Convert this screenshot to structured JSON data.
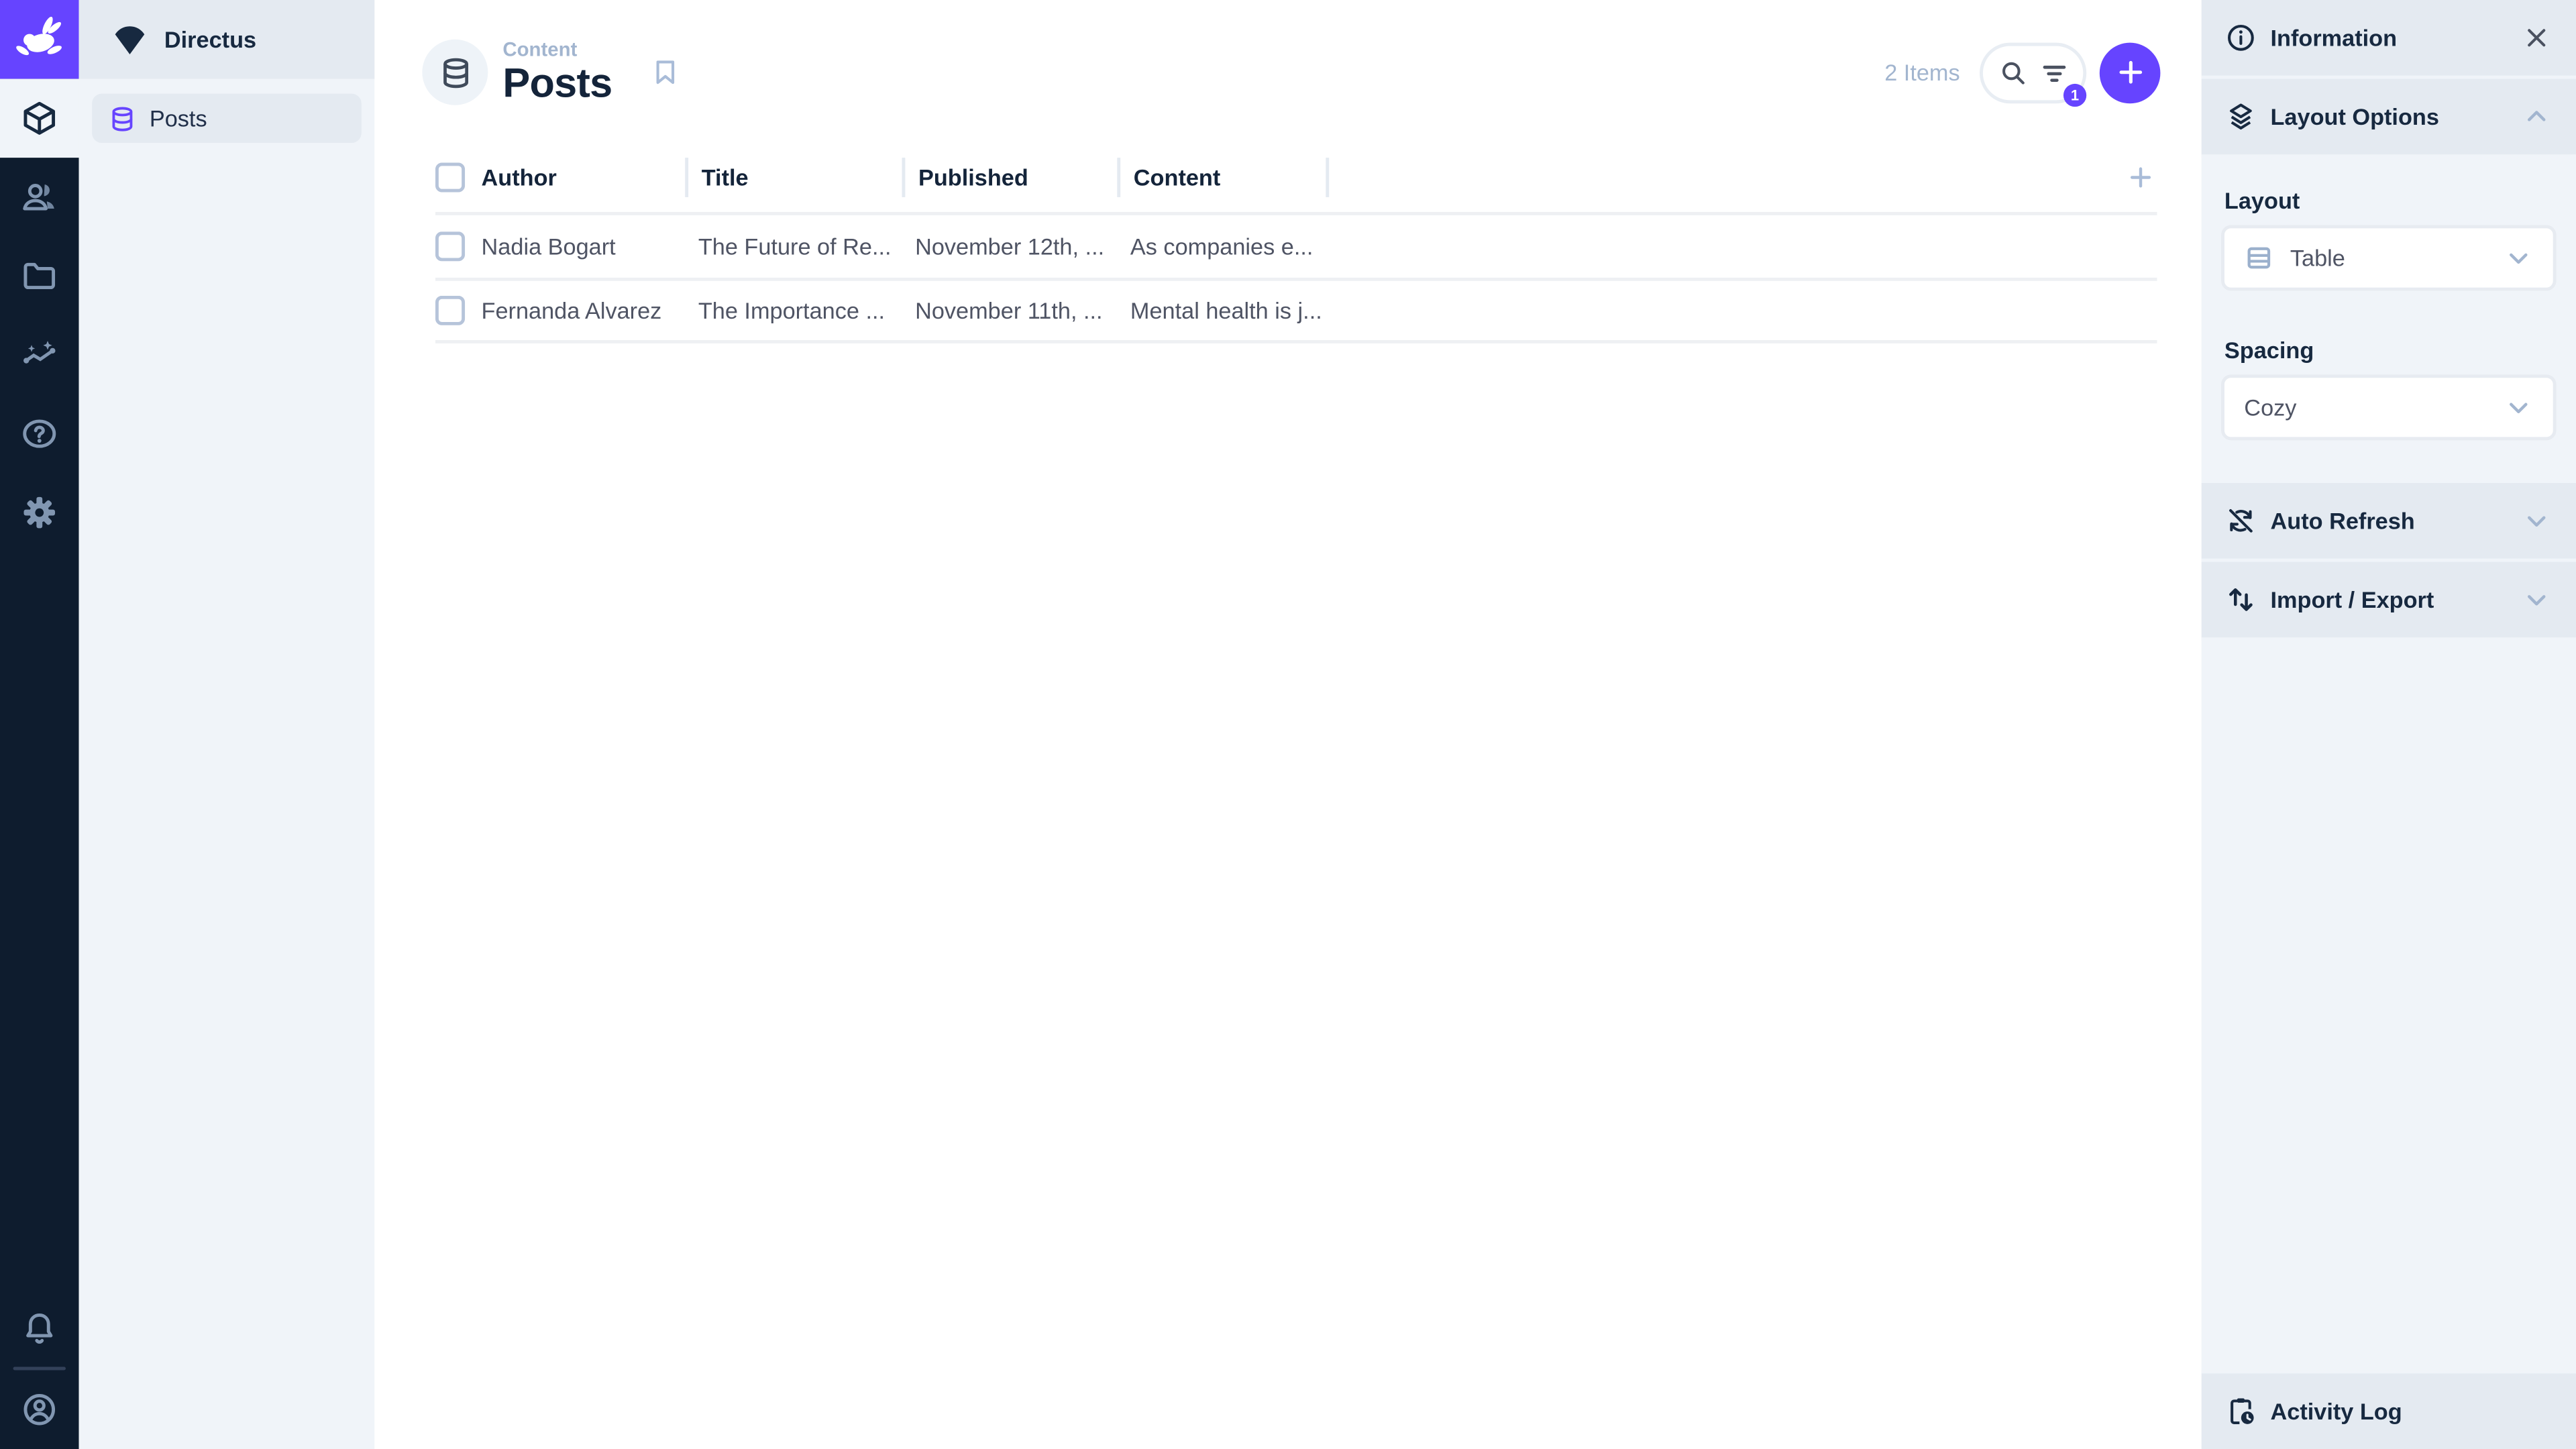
{
  "app": {
    "accent_color": "#6644ff",
    "module_bar_color": "#0e1c2e"
  },
  "sidebar": {
    "project_name": "Directus",
    "items": [
      {
        "label": "Posts",
        "icon": "database-icon",
        "active": true
      }
    ]
  },
  "header": {
    "breadcrumb": "Content",
    "title": "Posts",
    "items_count": "2 Items",
    "filter_badge_count": "1"
  },
  "table": {
    "columns": [
      "Author",
      "Title",
      "Published",
      "Content"
    ],
    "rows": [
      {
        "author": "Nadia Bogart",
        "title": "The Future of Re...",
        "published": "November 12th, ...",
        "content": "As companies e..."
      },
      {
        "author": "Fernanda Alvarez",
        "title": "The Importance ...",
        "published": "November 11th, ...",
        "content": "Mental health is j..."
      }
    ]
  },
  "panel": {
    "information_label": "Information",
    "layout_options_label": "Layout Options",
    "layout_label": "Layout",
    "layout_value": "Table",
    "spacing_label": "Spacing",
    "spacing_value": "Cozy",
    "auto_refresh_label": "Auto Refresh",
    "import_export_label": "Import / Export",
    "activity_log_label": "Activity Log"
  }
}
